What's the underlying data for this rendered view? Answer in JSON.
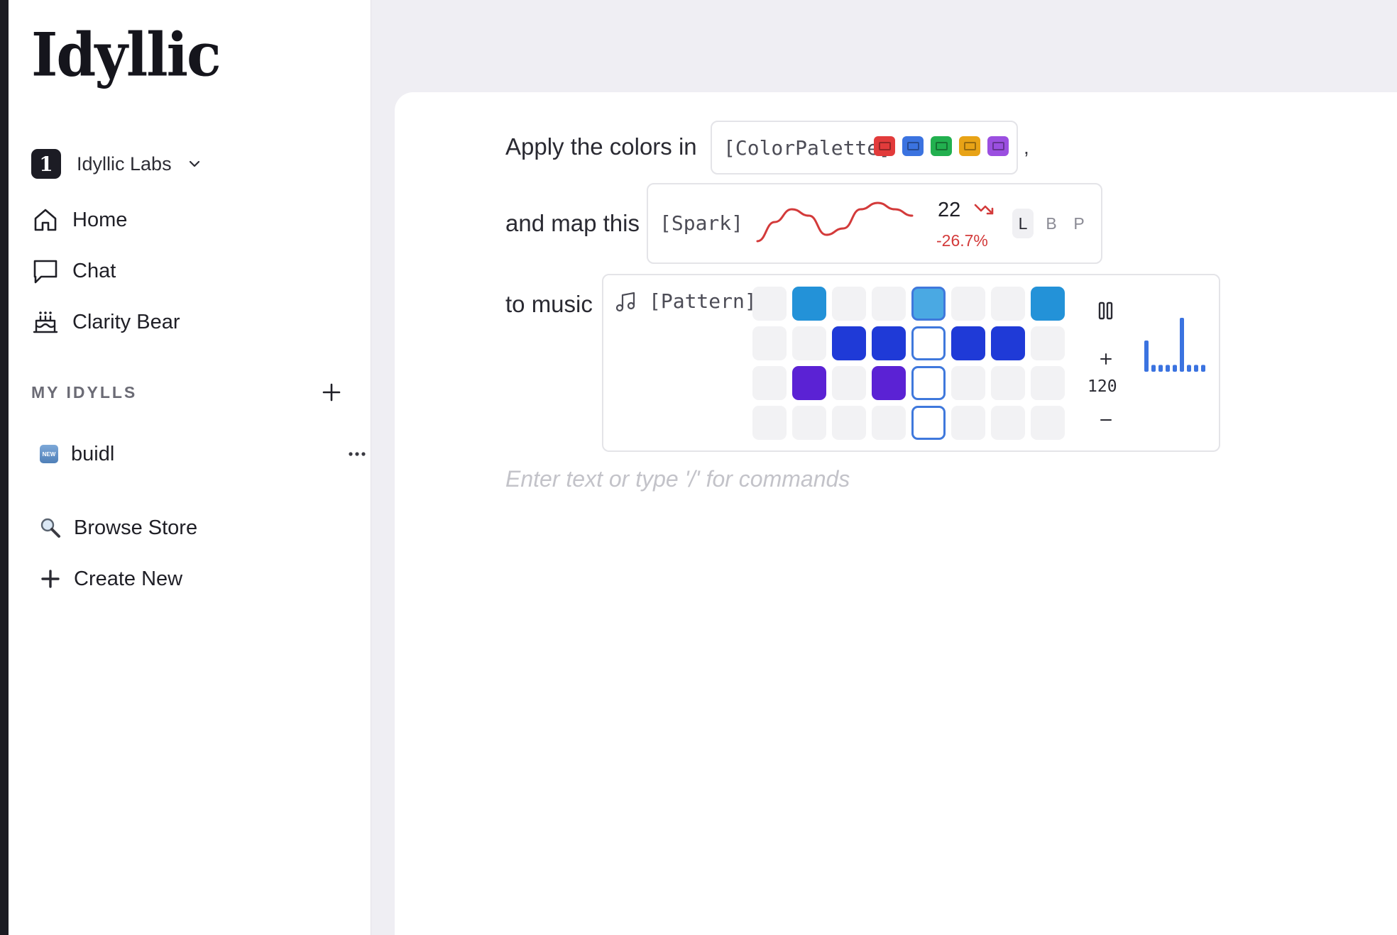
{
  "app": {
    "logo_text": "Idyllic"
  },
  "workspace": {
    "badge": "1",
    "name": "Idyllic Labs"
  },
  "nav": {
    "home": "Home",
    "chat": "Chat",
    "clarity_bear": "Clarity Bear"
  },
  "my_idylls": {
    "title": "MY IDYLLS",
    "items": [
      {
        "badge": "NEW",
        "label": "buidl"
      }
    ]
  },
  "bottom_nav": {
    "browse": "Browse Store",
    "create": "Create New"
  },
  "editor": {
    "line1": "Apply the colors in",
    "line2": "and map this",
    "line3": "to music",
    "comma": ",",
    "placeholder": "Enter text or type '/' for commands"
  },
  "color_palette": {
    "tag": "[ColorPalette]",
    "colors": [
      "#e23b3b",
      "#3b73e0",
      "#22b04f",
      "#e8a316",
      "#9b4fe0"
    ]
  },
  "spark": {
    "tag": "[Spark]",
    "value": "22",
    "change": "-26.7%",
    "trend_color": "#d33a3a",
    "series": [
      2,
      5,
      7,
      6,
      3,
      4,
      7,
      8,
      7,
      6
    ],
    "modes": [
      "L",
      "B",
      "P"
    ],
    "active_mode": "L"
  },
  "pattern": {
    "tag": "[Pattern]",
    "tempo": "120",
    "current_step": 4,
    "grid": [
      [
        "",
        "#2392d8",
        "",
        "",
        "#4aa9e3",
        "",
        "",
        "#2392d8"
      ],
      [
        "",
        "",
        "#1f3ad7",
        "#1f3ad7",
        "",
        "#1f3ad7",
        "#1f3ad7",
        ""
      ],
      [
        "",
        "#5b22d4",
        "",
        "#5b22d4",
        "",
        "",
        "",
        ""
      ],
      [
        "",
        "",
        "",
        "",
        "",
        "",
        "",
        ""
      ]
    ],
    "meter_levels": [
      0.55,
      0.12,
      0.12,
      0.12,
      0.12,
      0.95,
      0.12,
      0.12,
      0.12
    ],
    "meter_color": "#3b73e0"
  }
}
